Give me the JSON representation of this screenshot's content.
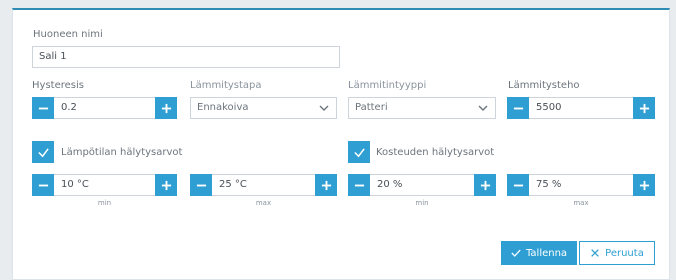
{
  "room_name": {
    "label": "Huoneen nimi",
    "value": "Sali 1"
  },
  "hysteresis": {
    "label": "Hysteresis",
    "value": "0.2"
  },
  "heating_method": {
    "label": "Lämmitystapa",
    "selected": "Ennakoiva"
  },
  "heater_type": {
    "label": "Lämmitintyyppi",
    "selected": "Patteri"
  },
  "heating_power": {
    "label": "Lämmitysteho",
    "value": "5500"
  },
  "temperature_alarms": {
    "label": "Lämpötilan hälytysarvot",
    "checked": true,
    "min_value": "10 °C",
    "max_value": "25 °C",
    "min_label": "min",
    "max_label": "max"
  },
  "humidity_alarms": {
    "label": "Kosteuden hälytysarvot",
    "checked": true,
    "min_value": "20 %",
    "max_value": "75 %",
    "min_label": "min",
    "max_label": "max"
  },
  "actions": {
    "save_label": "Tallenna",
    "cancel_label": "Peruuta"
  },
  "colors": {
    "accent": "#2f9fd3",
    "header_border": "#2f8db4"
  }
}
